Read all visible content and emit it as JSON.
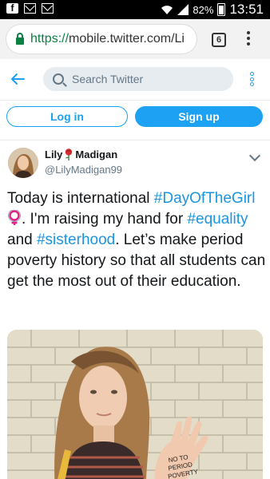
{
  "status_bar": {
    "battery": "82%",
    "time": "13:51",
    "notification_icons": [
      "facebook-icon",
      "mail-icon",
      "mail-icon"
    ]
  },
  "browser": {
    "url_scheme": "https://",
    "url_host": "mobile.twitter.com/Li",
    "tab_count": "6"
  },
  "header": {
    "search_placeholder": "Search Twitter"
  },
  "auth": {
    "login_label": "Log in",
    "signup_label": "Sign up"
  },
  "tweet": {
    "name_first": "Lily",
    "name_last": "Madigan",
    "handle": "@LilyMadigan99",
    "text": {
      "p1": "Today is international ",
      "tag1": "#DayOfTheGirl",
      "p2": ". I'm raising my hand for ",
      "tag2": "#equality",
      "p3": " and ",
      "tag3": "#sisterhood",
      "p4": ". Let’s make period poverty history so that all students can get the most out of their education."
    },
    "image_hand_text": "NO TO PERIOD POVERTY"
  },
  "colors": {
    "twitter_blue": "#1da1f2",
    "link_blue": "#1b95e0",
    "secure_green": "#0b8043",
    "venus_pink": "#e0218a"
  }
}
